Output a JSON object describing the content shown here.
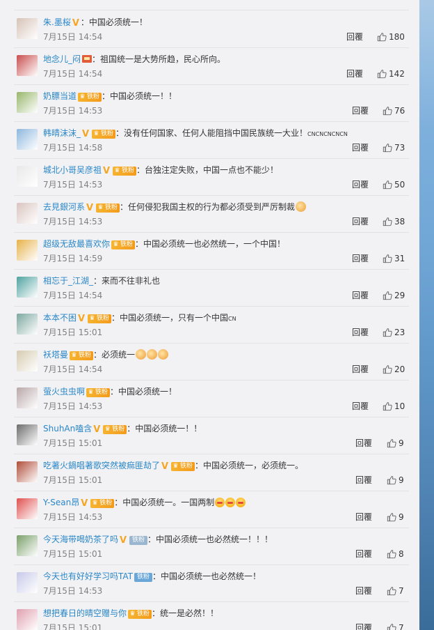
{
  "reply_label": "回覆",
  "comments": [
    {
      "user": "朱.墨桜",
      "verified": true,
      "badge": "",
      "fan_badge": false,
      "flag": false,
      "text": "：中国必须统一！",
      "emoji": "",
      "time": "7月15日 14:54",
      "likes": "180",
      "avatar_color": "#d6c3b7"
    },
    {
      "user": "地念儿_闷",
      "verified": false,
      "badge": "",
      "fan_badge": false,
      "flag": true,
      "text": "：祖国统一是大势所趋，民心所向。",
      "emoji": "",
      "time": "7月15日 14:54",
      "likes": "142",
      "avatar_color": "#c94d4d"
    },
    {
      "user": "奶膘当道",
      "verified": false,
      "badge": "铁粉",
      "fan_badge": true,
      "flag": false,
      "text": "：中国必须统一！！",
      "emoji": "",
      "time": "7月15日 14:53",
      "likes": "76",
      "avatar_color": "#98b66c"
    },
    {
      "user": "韩晴沫沫_",
      "verified": true,
      "badge": "铁粉",
      "fan_badge": true,
      "flag": false,
      "text": "：没有任何国家、任何人能阻挡中国民族统一大业！",
      "small": "CNCNCNCNCN",
      "emoji": "",
      "time": "7月15日 14:58",
      "likes": "73",
      "avatar_color": "#8eb7de"
    },
    {
      "user": "城北小哥吴彦祖",
      "verified": true,
      "badge": "铁粉",
      "fan_badge": true,
      "flag": false,
      "text": "：台独注定失败，中国一点也不能少！",
      "emoji": "",
      "time": "7月15日 14:53",
      "likes": "50",
      "avatar_color": "#e8e8e8"
    },
    {
      "user": "去見銀河系",
      "verified": true,
      "badge": "铁粉",
      "fan_badge": true,
      "flag": false,
      "text": "：任何侵犯我国主权的行为都必须受到严厉制裁",
      "emoji": "fist1",
      "time": "7月15日 14:53",
      "likes": "38",
      "avatar_color": "#d9c4c0"
    },
    {
      "user": "超级无敌最喜欢你",
      "verified": false,
      "badge": "铁粉",
      "fan_badge": true,
      "flag": false,
      "text": "：中国必须统一也必然统一，一个中国！",
      "emoji": "",
      "time": "7月15日 14:59",
      "likes": "31",
      "avatar_color": "#e7b24a"
    },
    {
      "user": "相忘于_江湖_",
      "verified": false,
      "badge": "",
      "fan_badge": false,
      "flag": false,
      "text": "：来而不往非礼也",
      "emoji": "",
      "time": "7月15日 14:54",
      "likes": "29",
      "avatar_color": "#4fa3a0"
    },
    {
      "user": "本本不困",
      "verified": true,
      "badge": "铁粉",
      "fan_badge": true,
      "flag": false,
      "text": "：中国必须统一，只有一个中国",
      "small": "CN",
      "emoji": "",
      "time": "7月15日 15:01",
      "likes": "23",
      "avatar_color": "#7ea8a0"
    },
    {
      "user": "袄塔曼",
      "verified": false,
      "badge": "铁粉",
      "fan_badge": true,
      "flag": false,
      "text": "：必须统一",
      "emoji": "fist3",
      "time": "7月15日 14:54",
      "likes": "20",
      "avatar_color": "#d6cbb1"
    },
    {
      "user": "萤火虫虫啊",
      "verified": false,
      "badge": "铁粉",
      "fan_badge": true,
      "flag": false,
      "text": "：中国必须统一！",
      "emoji": "",
      "time": "7月15日 14:53",
      "likes": "10",
      "avatar_color": "#b9a7a9"
    },
    {
      "user": "ShuhAn嗑含",
      "verified": true,
      "badge": "铁粉",
      "fan_badge": true,
      "flag": false,
      "text": "：中国必须统一！！",
      "emoji": "",
      "time": "7月15日 15:01",
      "likes": "9",
      "avatar_color": "#6d6d6d"
    },
    {
      "user": "吃著火鍋唱著歌突然被痲匪劫了",
      "verified": true,
      "badge": "铁粉",
      "fan_badge": true,
      "flag": false,
      "text": "：中国必须统一，必须统一。",
      "emoji": "",
      "time": "7月15日 15:01",
      "likes": "9",
      "avatar_color": "#b04d3a"
    },
    {
      "user": "Y-Sean昂",
      "verified": true,
      "badge": "铁粉",
      "fan_badge": true,
      "flag": false,
      "text": "：中国必须统一。一国两制",
      "emoji": "cry3",
      "time": "7月15日 14:53",
      "likes": "9",
      "avatar_color": "#e05050"
    },
    {
      "user": "今天海带喝奶茶了吗",
      "verified": true,
      "badge": "铁粉",
      "fan_badge": false,
      "badge_style": "gray",
      "flag": false,
      "text": "：中国必须统一也必然统一！！！",
      "emoji": "",
      "time": "7月15日 15:01",
      "likes": "8",
      "avatar_color": "#7aa06a"
    },
    {
      "user": "今天也有好好学习吗TAT",
      "verified": false,
      "badge": "铁粉",
      "fan_badge": false,
      "badge_style": "blue",
      "flag": false,
      "text": "：中国必须统一也必然统一！",
      "emoji": "",
      "time": "7月15日 14:53",
      "likes": "7",
      "avatar_color": "#c7c9e8"
    },
    {
      "user": "想把春日的晴空赠与你",
      "verified": false,
      "badge": "铁粉",
      "fan_badge": true,
      "flag": false,
      "text": "：统一是必然！！",
      "emoji": "",
      "time": "7月15日 15:01",
      "likes": "7",
      "avatar_color": "#e0a0b0"
    }
  ]
}
